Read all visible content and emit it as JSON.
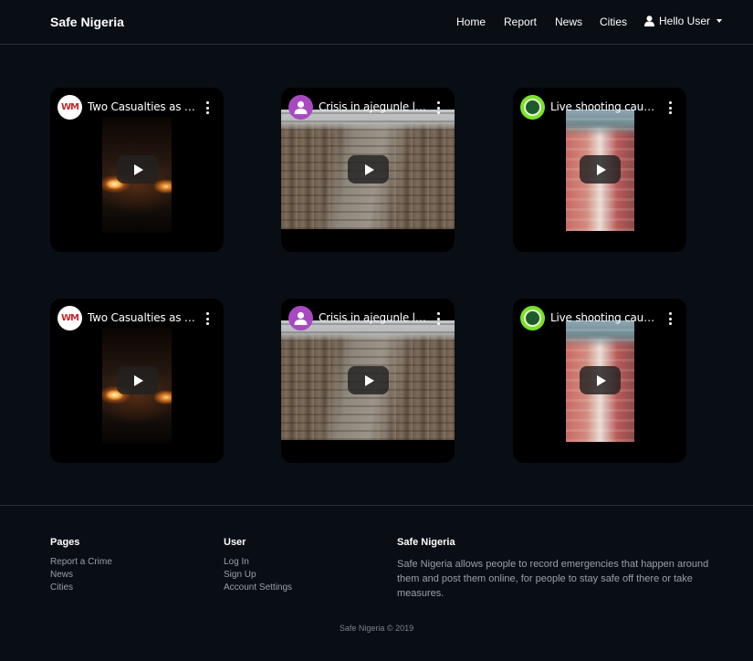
{
  "navbar": {
    "brand": "Safe Nigeria",
    "links": [
      "Home",
      "Report",
      "News",
      "Cities"
    ],
    "user_label": "Hello User"
  },
  "videos": [
    {
      "title": "Two Casualties as F...",
      "avatar": "WM",
      "thumbnail": "night-fire"
    },
    {
      "title": "Crisis in ajegunle la...",
      "avatar": "person-icon",
      "thumbnail": "street-crowd"
    },
    {
      "title": "Live shooting caugh...",
      "avatar": "green-badge-icon",
      "thumbnail": "vertical-street"
    },
    {
      "title": "Two Casualties as F...",
      "avatar": "WM",
      "thumbnail": "night-fire"
    },
    {
      "title": "Crisis in ajegunle la...",
      "avatar": "person-icon",
      "thumbnail": "street-crowd"
    },
    {
      "title": "Live shooting caugh...",
      "avatar": "green-badge-icon",
      "thumbnail": "vertical-street"
    }
  ],
  "footer": {
    "pages_heading": "Pages",
    "pages_links": [
      "Report a Crime",
      "News",
      "Cities"
    ],
    "user_heading": "User",
    "user_links": [
      "Log In",
      "Sign Up",
      "Account Settings"
    ],
    "about_heading": "Safe Nigeria",
    "about_text": "Safe Nigeria allows people to record emergencies that happen around them and post them online, for people to stay safe off there or take measures.",
    "copyright": "Safe Nigeria © 2019"
  },
  "colors": {
    "background": "#090d14",
    "card": "#000000",
    "muted_text": "#9aa0a8",
    "divider": "#2a2f38"
  }
}
